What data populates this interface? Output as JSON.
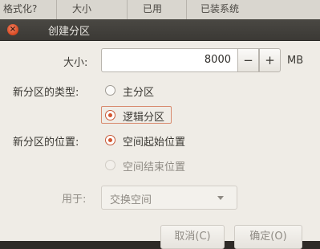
{
  "background_table": {
    "headers": [
      "格式化?",
      "大小",
      "已用",
      "已装系统"
    ]
  },
  "dialog": {
    "title": "创建分区",
    "size": {
      "label": "大小:",
      "value": "8000",
      "minus": "−",
      "plus": "+",
      "unit": "MB"
    },
    "type": {
      "label": "新分区的类型:",
      "options": [
        {
          "label": "主分区",
          "checked": false,
          "enabled": true
        },
        {
          "label": "逻辑分区",
          "checked": true,
          "enabled": true
        }
      ]
    },
    "location": {
      "label": "新分区的位置:",
      "options": [
        {
          "label": "空间起始位置",
          "checked": true,
          "enabled": true
        },
        {
          "label": "空间结束位置",
          "checked": false,
          "enabled": false
        }
      ]
    },
    "use_as": {
      "label": "用于:",
      "value": "交换空间"
    },
    "buttons": {
      "cancel": "取消(C)",
      "ok": "确定(O)"
    }
  },
  "colors": {
    "accent": "#d45630",
    "titlebar": "#3b3935",
    "dialog_bg": "#efece6"
  }
}
